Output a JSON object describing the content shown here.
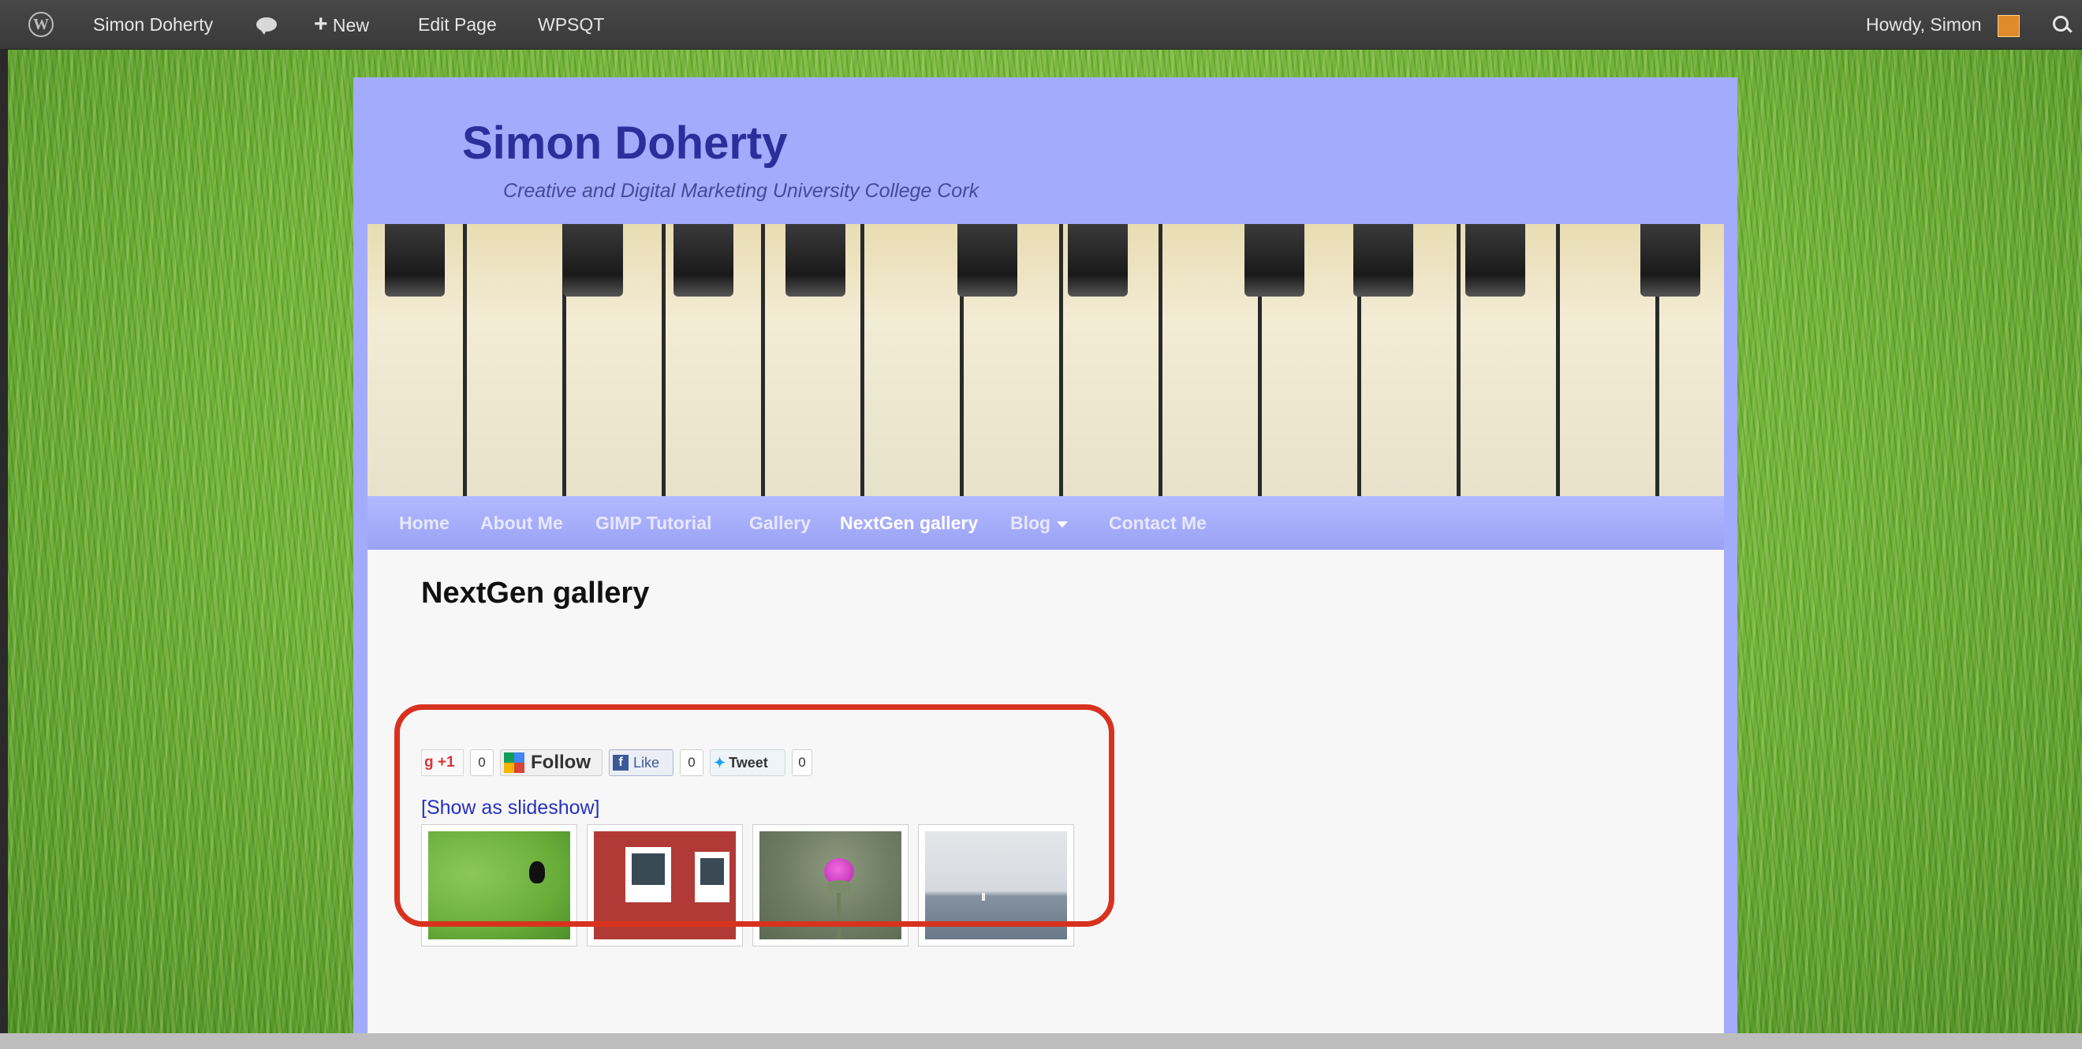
{
  "admin_bar": {
    "site_name": "Simon Doherty",
    "new_label": "New",
    "edit_page": "Edit Page",
    "plugin": "WPSQT",
    "howdy": "Howdy, Simon",
    "icons": [
      "wordpress-logo-icon",
      "comment-bubble-icon",
      "plus-icon",
      "avatar",
      "search-icon"
    ]
  },
  "site": {
    "title": "Simon Doherty",
    "description": "Creative and Digital Marketing University College Cork",
    "background_color": "#a3abfc",
    "title_color": "#2b2f9b"
  },
  "nav": {
    "items": [
      {
        "label": "Home"
      },
      {
        "label": "About Me"
      },
      {
        "label": "GIMP Tutorial"
      },
      {
        "label": "Gallery"
      },
      {
        "label": "NextGen gallery",
        "current": true
      },
      {
        "label": "Blog",
        "has_dropdown": true
      },
      {
        "label": "Contact Me"
      }
    ]
  },
  "page": {
    "title": "NextGen gallery"
  },
  "share": {
    "gplus": {
      "label": "+1",
      "count": "0"
    },
    "follow": {
      "label": "Follow"
    },
    "facebook": {
      "label": "Like",
      "count": "0"
    },
    "twitter": {
      "label": "Tweet",
      "count": "0"
    }
  },
  "gallery": {
    "slideshow_link": "[Show as slideshow]",
    "thumbnails": [
      {
        "subject": "crow on grass"
      },
      {
        "subject": "red wall with white shuttered windows"
      },
      {
        "subject": "pink thistle flower"
      },
      {
        "subject": "sea horizon with small sailboat"
      }
    ],
    "highlight_color": "#d8321f"
  }
}
